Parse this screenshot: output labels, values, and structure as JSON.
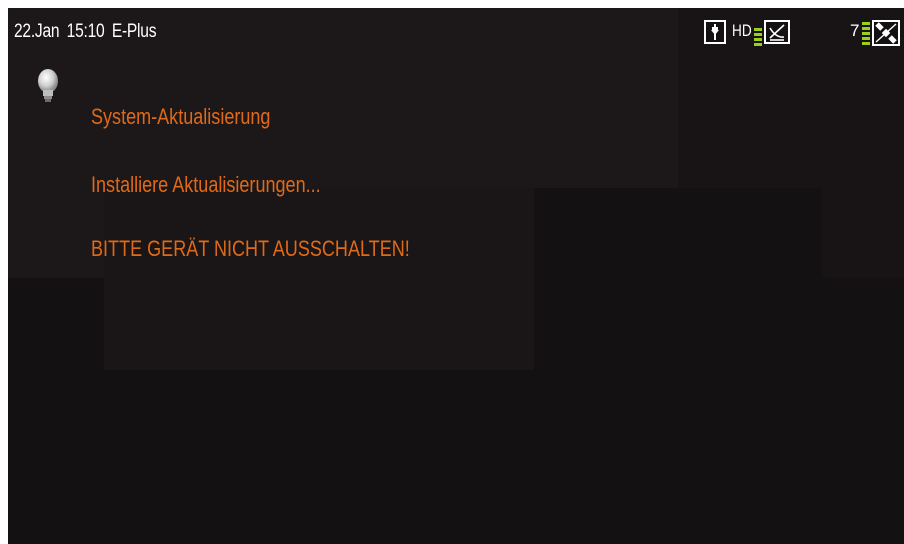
{
  "status_bar": {
    "date": "22.Jan",
    "time": "15:10",
    "network": "E-Plus",
    "hd_label": "HD",
    "channel_number": "7"
  },
  "icons": [
    "bulb-icon",
    "usb-connector-icon",
    "satellite-dish-icon",
    "satellite-icon"
  ],
  "messages": {
    "title": "System-Aktualisierung",
    "progress": "Installiere Aktualisierungen...",
    "warning": "BITTE GERÄT NICHT AUSSCHALTEN!"
  },
  "colors": {
    "background": "#141112",
    "message_text": "#e06a18",
    "status_text": "#ffffff",
    "signal_bar": "#9bcf1d"
  }
}
